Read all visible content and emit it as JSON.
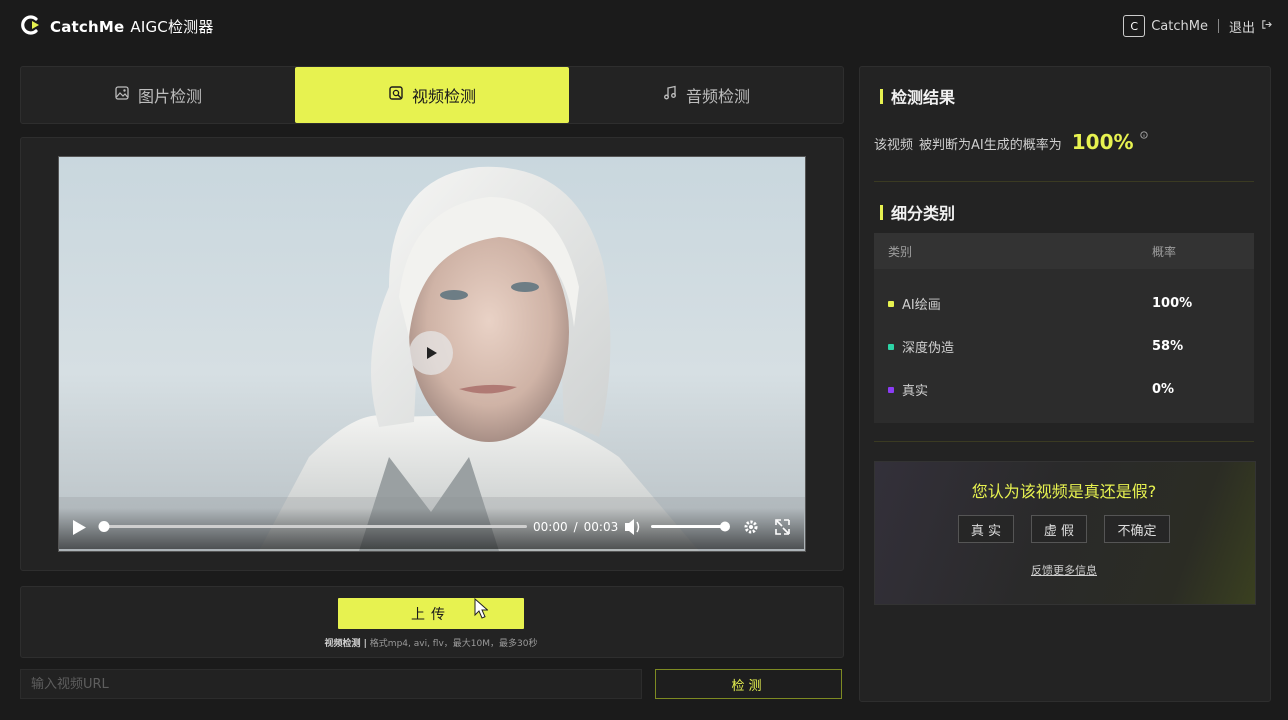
{
  "header": {
    "brand": "CatchMe",
    "app_name": "AIGC检测器",
    "user_name": "CatchMe",
    "avatar_text": "C",
    "logout": "退出"
  },
  "tabs": [
    {
      "label": "图片检测",
      "icon": "image-icon",
      "active": false
    },
    {
      "label": "视频检测",
      "icon": "video-search-icon",
      "active": true
    },
    {
      "label": "音频检测",
      "icon": "music-note-icon",
      "active": false
    }
  ],
  "player": {
    "current_time": "00:00",
    "separator": "/",
    "duration": "00:03",
    "progress": 0,
    "volume": 1.0
  },
  "upload": {
    "button_label": "上传",
    "hint_bold": "视频检测 |",
    "hint_text": " 格式mp4, avi, flv，最大10M，最多30秒"
  },
  "url": {
    "placeholder": "输入视频URL",
    "value": "",
    "detect_label": "检测"
  },
  "result": {
    "title": "检测结果",
    "subject": "该视频",
    "text": "被判断为AI生成的概率为",
    "percent": "100%",
    "info_icon": "info-circle-icon"
  },
  "breakdown": {
    "title": "细分类别",
    "col_category": "类别",
    "col_prob": "概率",
    "rows": [
      {
        "label": "AI绘画",
        "value": "100%",
        "color": "#e7f250"
      },
      {
        "label": "深度伪造",
        "value": "58%",
        "color": "#2dd4a6"
      },
      {
        "label": "真实",
        "value": "0%",
        "color": "#8b3cf5"
      }
    ]
  },
  "vote": {
    "question": "您认为该视频是真还是假?",
    "buttons": [
      "真 实",
      "虚 假",
      "不确定"
    ],
    "feedback": "反馈更多信息"
  },
  "colors": {
    "accent": "#e7f250",
    "background": "#1b1b1b",
    "panel": "#232323"
  }
}
